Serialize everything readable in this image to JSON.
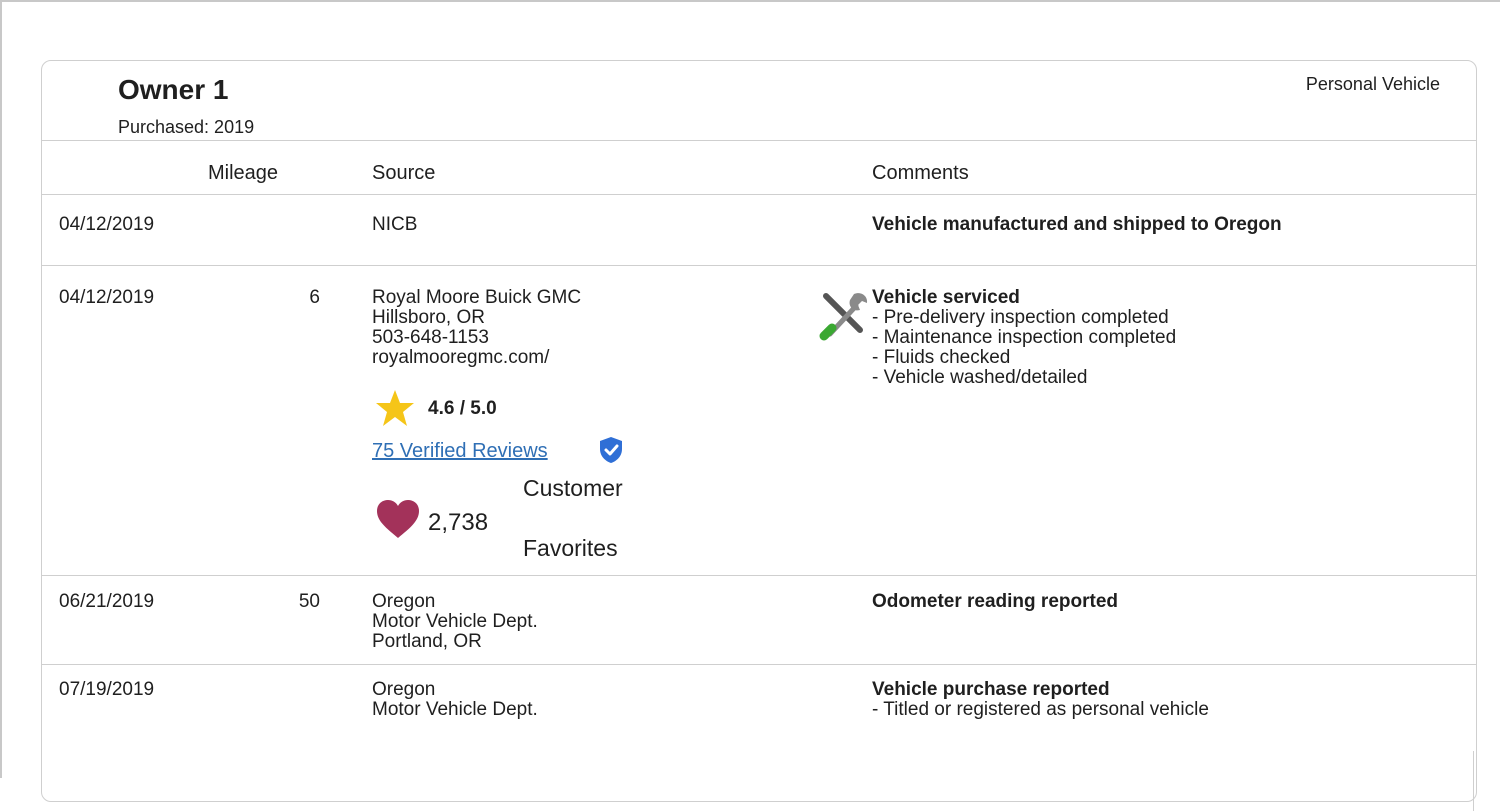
{
  "owner": {
    "title": "Owner 1",
    "purchased": "Purchased: 2019",
    "vehicle_type": "Personal Vehicle"
  },
  "table": {
    "headers": {
      "mileage": "Mileage",
      "source": "Source",
      "comments": "Comments"
    },
    "rows": [
      {
        "date": "04/12/2019",
        "mileage": "",
        "source": [
          "NICB"
        ],
        "comment_title": "Vehicle manufactured and shipped to Oregon",
        "comment_lines": []
      },
      {
        "date": "04/12/2019",
        "mileage": "6",
        "source": [
          "Royal Moore Buick GMC",
          "Hillsboro, OR",
          "503-648-1153",
          "royalmooregmc.com/"
        ],
        "rating": "4.6 / 5.0",
        "reviews_link": "75 Verified Reviews",
        "favorites_count": "2,738",
        "favorites_label_1": "Customer",
        "favorites_label_2": "Favorites",
        "comment_title": "Vehicle serviced",
        "comment_lines": [
          "- Pre-delivery inspection completed",
          "- Maintenance inspection completed",
          "- Fluids checked",
          "- Vehicle washed/detailed"
        ]
      },
      {
        "date": "06/21/2019",
        "mileage": "50",
        "source": [
          "Oregon",
          "Motor Vehicle Dept.",
          "Portland, OR"
        ],
        "comment_title": "Odometer reading reported",
        "comment_lines": []
      },
      {
        "date": "07/19/2019",
        "mileage": "",
        "source": [
          "Oregon",
          "Motor Vehicle Dept."
        ],
        "comment_title": "Vehicle purchase reported",
        "comment_lines": [
          "- Titled or registered as personal vehicle"
        ]
      }
    ]
  },
  "icons": {
    "service": "wrench-screwdriver-icon",
    "star": "star-icon",
    "verified": "verified-badge-icon",
    "heart": "heart-icon"
  },
  "colors": {
    "link": "#2f6fb5",
    "star": "#f5c518",
    "verified": "#2f6fd6",
    "heart": "#a3325a",
    "border": "#cfcfcf"
  }
}
